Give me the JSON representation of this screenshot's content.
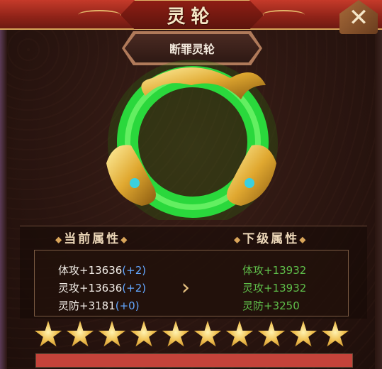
{
  "header": {
    "title": "灵轮",
    "close_icon": "close-icon"
  },
  "item": {
    "name": "断罪灵轮"
  },
  "attributes": {
    "current_header": "当前属性",
    "next_header": "下级属性",
    "current": [
      {
        "label": "体攻+13636",
        "increase": "(+2)"
      },
      {
        "label": "灵攻+13636",
        "increase": "(+2)"
      },
      {
        "label": "灵防+3181",
        "increase": "(+0)"
      }
    ],
    "next": [
      "体攻+13932",
      "灵攻+13932",
      "灵防+3250"
    ],
    "arrow_icon": "double-chevron-right-icon"
  },
  "stars": {
    "count": 10,
    "filled": 10
  },
  "progress": {
    "fraction": 1.0
  },
  "colors": {
    "title_bar": "#c53a2a",
    "increase_blue": "#63a7ff",
    "next_green": "#5fbf4a",
    "star_gold": "#f0c050",
    "progress_red": "#c4433a"
  }
}
